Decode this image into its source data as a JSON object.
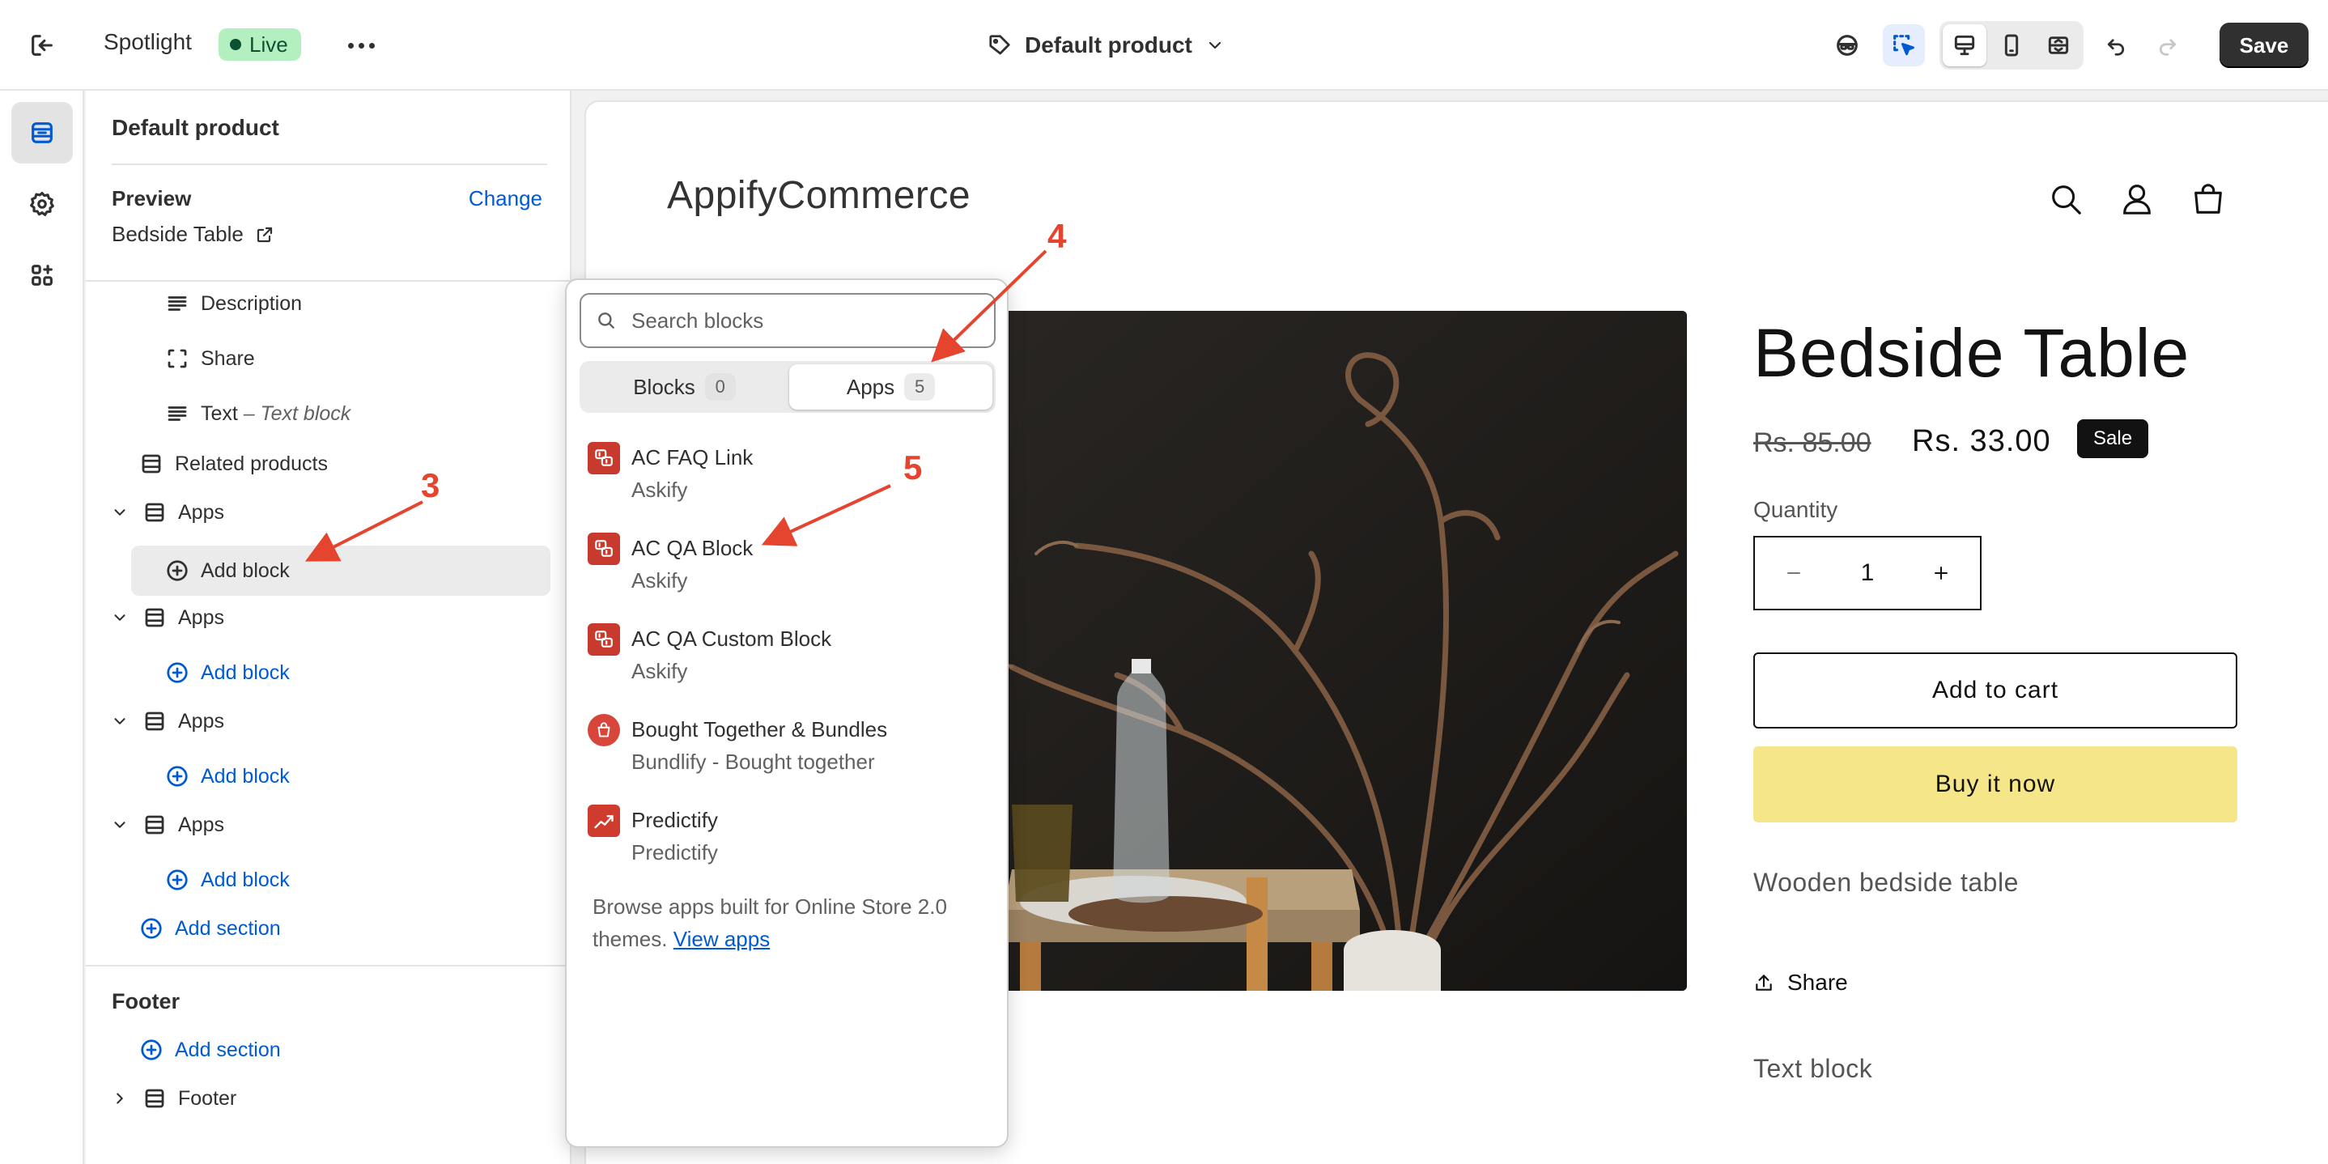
{
  "topbar": {
    "theme_name": "Spotlight",
    "status_badge": "Live",
    "template_name": "Default product",
    "save_label": "Save"
  },
  "sidebar": {
    "title": "Default product",
    "preview_label": "Preview",
    "change_label": "Change",
    "preview_item": "Bedside Table",
    "tree": {
      "description": "Description",
      "share": "Share",
      "text": "Text",
      "text_sep": " – ",
      "text_sub": "Text block",
      "related_products": "Related products",
      "apps": "Apps",
      "add_block": "Add block",
      "add_section": "Add section"
    },
    "footer_group": "Footer",
    "footer_add_section": "Add section",
    "footer_item": "Footer"
  },
  "block_picker": {
    "search_placeholder": "Search blocks",
    "tabs": [
      {
        "label": "Blocks",
        "count": "0"
      },
      {
        "label": "Apps",
        "count": "5"
      }
    ],
    "active_tab": "Apps",
    "apps": [
      {
        "name": "AC FAQ Link",
        "vendor": "Askify"
      },
      {
        "name": "AC QA Block",
        "vendor": "Askify"
      },
      {
        "name": "AC QA Custom Block",
        "vendor": "Askify"
      },
      {
        "name": "Bought Together & Bundles",
        "vendor": "Bundlify - Bought together"
      },
      {
        "name": "Predictify",
        "vendor": "Predictify"
      }
    ],
    "browse_text": "Browse apps built for Online Store 2.0 themes.",
    "browse_link": "View apps"
  },
  "storefront": {
    "logo": "AppifyCommerce",
    "product_title": "Bedside Table",
    "compare_price": "Rs. 85.00",
    "price": "Rs. 33.00",
    "sale_badge": "Sale",
    "quantity_label": "Quantity",
    "quantity_value": "1",
    "add_to_cart": "Add to cart",
    "buy_now": "Buy it now",
    "short_description": "Wooden bedside table",
    "share_label": "Share",
    "text_block": "Text block"
  },
  "annotations": {
    "step3": "3",
    "step4": "4",
    "step5": "5"
  },
  "colors": {
    "accent_link": "#005bd3",
    "live_badge_bg": "#b4f0bf",
    "annotation_red": "#e5452f",
    "buy_now_bg": "#f5e68a"
  }
}
